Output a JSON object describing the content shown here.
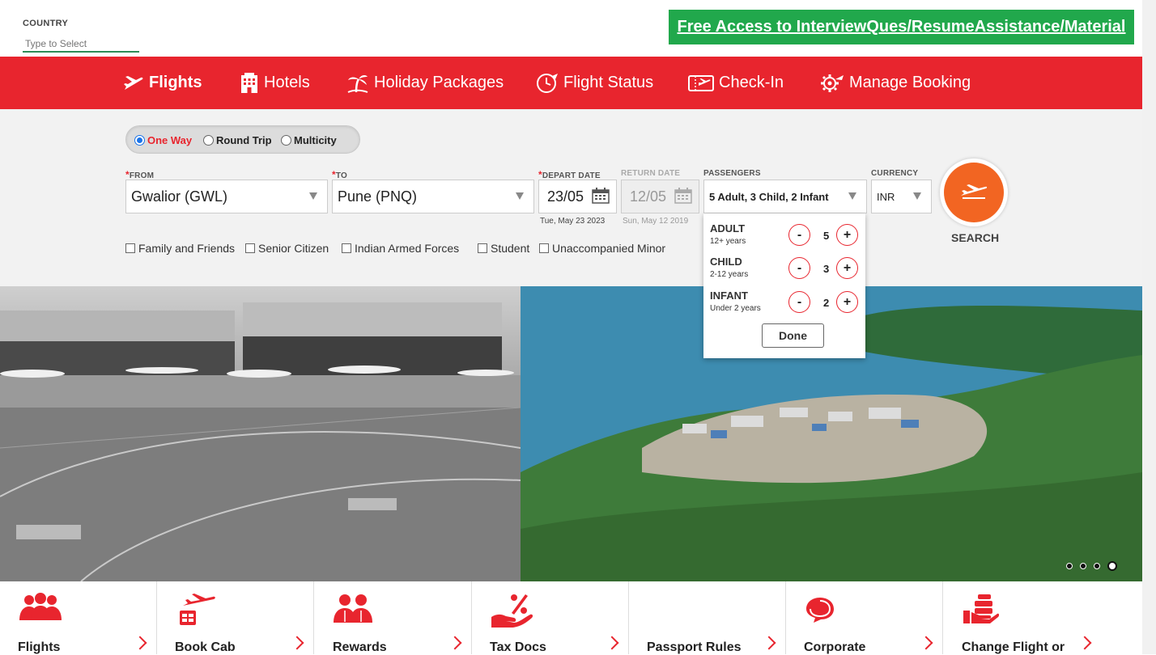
{
  "top": {
    "country_label": "COUNTRY",
    "country_placeholder": "Type to Select",
    "promo": "Free Access to InterviewQues/ResumeAssistance/Material"
  },
  "nav": [
    {
      "label": "Flights",
      "icon": "plane-icon",
      "active": true
    },
    {
      "label": "Hotels",
      "icon": "building-icon"
    },
    {
      "label": "Holiday Packages",
      "icon": "palm-tree-icon"
    },
    {
      "label": "Flight Status",
      "icon": "clock-plane-icon"
    },
    {
      "label": "Check-In",
      "icon": "ticket-icon"
    },
    {
      "label": "Manage Booking",
      "icon": "gear-plane-icon"
    }
  ],
  "trip": {
    "options": [
      "One Way",
      "Round Trip",
      "Multicity"
    ],
    "selected": "One Way"
  },
  "form": {
    "from_label": "FROM",
    "from_value": "Gwalior (GWL)",
    "to_label": "TO",
    "to_value": "Pune (PNQ)",
    "depart_label": "DEPART DATE",
    "depart_value": "23/05",
    "depart_sub": "Tue, May 23 2023",
    "return_label": "RETURN DATE",
    "return_value": "12/05",
    "return_sub": "Sun, May 12 2019",
    "pax_label": "PASSENGERS",
    "pax_value": "5 Adult, 3 Child, 2 Infant",
    "currency_label": "CURRENCY",
    "currency_value": "INR",
    "required_mark": "*"
  },
  "concessions": [
    "Family and Friends",
    "Senior Citizen",
    "Indian Armed Forces",
    "Student",
    "Unaccompanied Minor"
  ],
  "search_label": "SEARCH",
  "pax_popup": {
    "rows": [
      {
        "title": "ADULT",
        "sub": "12+ years",
        "value": "5"
      },
      {
        "title": "CHILD",
        "sub": "2-12 years",
        "value": "3"
      },
      {
        "title": "INFANT",
        "sub": "Under 2 years",
        "value": "2"
      }
    ],
    "minus": "-",
    "plus": "+",
    "done": "Done"
  },
  "hero": {
    "slides": 4,
    "current": 4
  },
  "tiles": [
    {
      "label": "Flights",
      "icon": "people-icon"
    },
    {
      "label": "Book Cab",
      "icon": "plane-luggage-icon"
    },
    {
      "label": "Rewards",
      "icon": "users-icon"
    },
    {
      "label": "Tax Docs",
      "icon": "percent-hand-icon"
    },
    {
      "label": "Passport Rules",
      "icon": "passport-icon"
    },
    {
      "label": "Corporate",
      "icon": "chat-icon"
    },
    {
      "label": "Change Flight or",
      "icon": "hand-coins-icon"
    }
  ],
  "colors": {
    "brand_red": "#e8252e",
    "promo_green": "#21a84c",
    "search_orange": "#f26522",
    "radio_blue": "#1a73e8"
  }
}
